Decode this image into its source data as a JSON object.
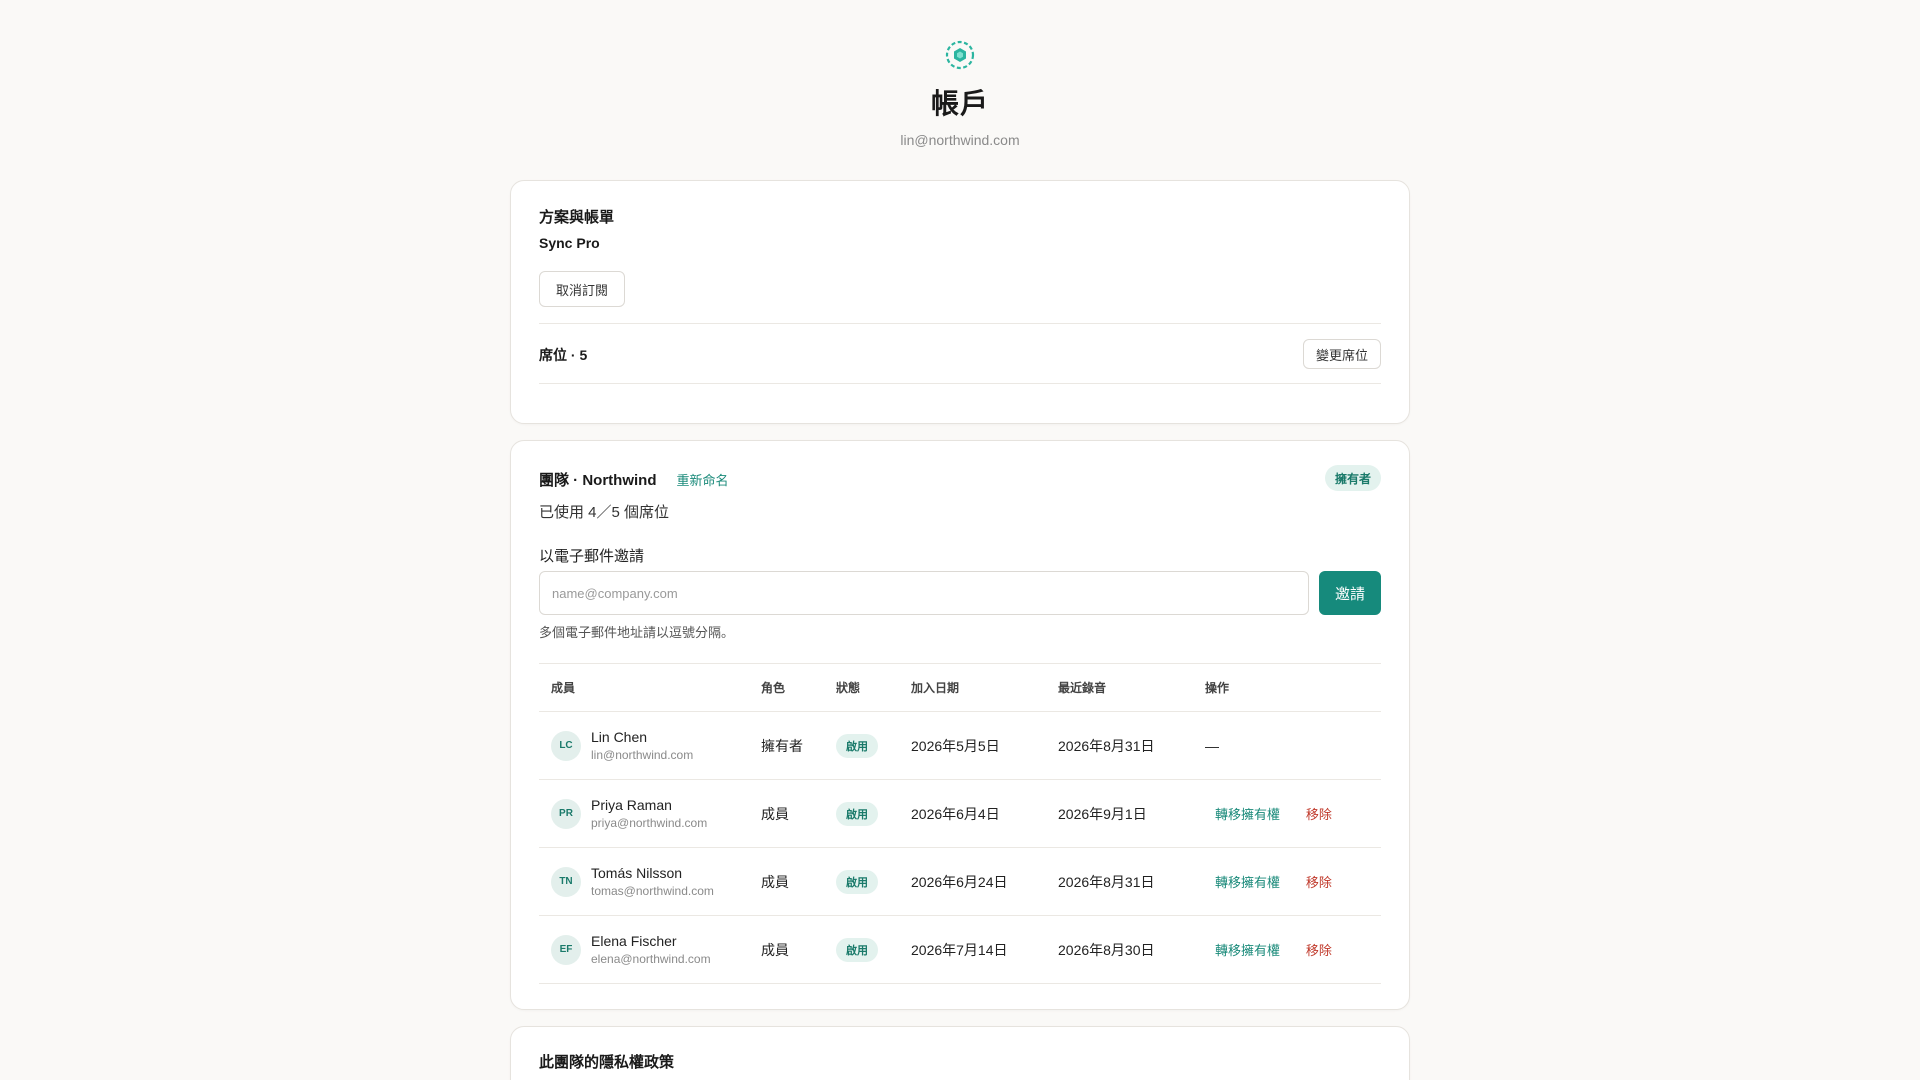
{
  "header": {
    "logo_icon": "hexagon-logo-icon",
    "title": "帳戶",
    "email": "lin@northwind.com"
  },
  "plan": {
    "heading": "方案與帳單",
    "plan_name": "Sync Pro",
    "cancel_label": "取消訂閱",
    "seats_label": "席位 · 5",
    "change_seats_label": "變更席位"
  },
  "team": {
    "title": "團隊 · Northwind",
    "rename_label": "重新命名",
    "owner_badge": "擁有者",
    "seat_usage": "已使用 4／5 個席位",
    "invite_label": "以電子郵件邀請",
    "invite_placeholder": "name@company.com",
    "invite_value": "",
    "invite_button": "邀請",
    "invite_hint": "多個電子郵件地址請以逗號分隔。",
    "columns": [
      "成員",
      "角色",
      "狀態",
      "加入日期",
      "最近錄音",
      "操作"
    ],
    "members": [
      {
        "initials": "LC",
        "name": "Lin Chen",
        "email": "lin@northwind.com",
        "role": "擁有者",
        "status": "啟用",
        "joined": "2026年5月5日",
        "last": "2026年8月31日",
        "action_dash": "—",
        "transfer": "",
        "remove": ""
      },
      {
        "initials": "PR",
        "name": "Priya Raman",
        "email": "priya@northwind.com",
        "role": "成員",
        "status": "啟用",
        "joined": "2026年6月4日",
        "last": "2026年9月1日",
        "action_dash": "",
        "transfer": "轉移擁有權",
        "remove": "移除"
      },
      {
        "initials": "TN",
        "name": "Tomás Nilsson",
        "email": "tomas@northwind.com",
        "role": "成員",
        "status": "啟用",
        "joined": "2026年6月24日",
        "last": "2026年8月31日",
        "action_dash": "",
        "transfer": "轉移擁有權",
        "remove": "移除"
      },
      {
        "initials": "EF",
        "name": "Elena Fischer",
        "email": "elena@northwind.com",
        "role": "成員",
        "status": "啟用",
        "joined": "2026年7月14日",
        "last": "2026年8月30日",
        "action_dash": "",
        "transfer": "轉移擁有權",
        "remove": "移除"
      }
    ]
  },
  "privacy": {
    "heading": "此團隊的隱私權政策"
  },
  "colors": {
    "accent": "#168a7c",
    "danger": "#c0392b",
    "background": "#faf9f7"
  }
}
